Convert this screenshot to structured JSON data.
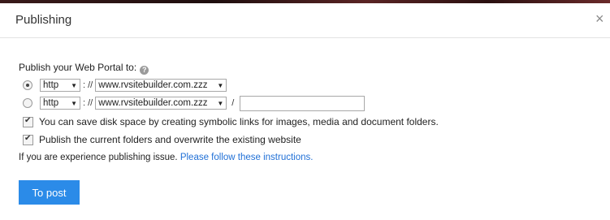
{
  "dialog": {
    "title": "Publishing",
    "close_glyph": "×"
  },
  "form": {
    "label": "Publish your Web Portal to:",
    "help_icon": "?",
    "option1": {
      "selected": true,
      "protocol": "http",
      "separator": ": //",
      "domain": "www.rvsitebuilder.com.zzz"
    },
    "option2": {
      "selected": false,
      "protocol": "http",
      "separator": ": //",
      "domain": "www.rvsitebuilder.com.zzz",
      "path_separator": "/",
      "path_value": ""
    },
    "symlink_checkbox": {
      "checked": true,
      "label": "You can save disk space by creating symbolic links for images, media and document folders."
    },
    "overwrite_checkbox": {
      "checked": true,
      "label": "Publish the current folders and overwrite the existing website"
    },
    "info_text": "If you are experience publishing issue.",
    "info_link": "Please follow these instructions."
  },
  "actions": {
    "post_label": "To post"
  },
  "colors": {
    "accent": "#2b8be8",
    "link": "#1f6fd6"
  }
}
